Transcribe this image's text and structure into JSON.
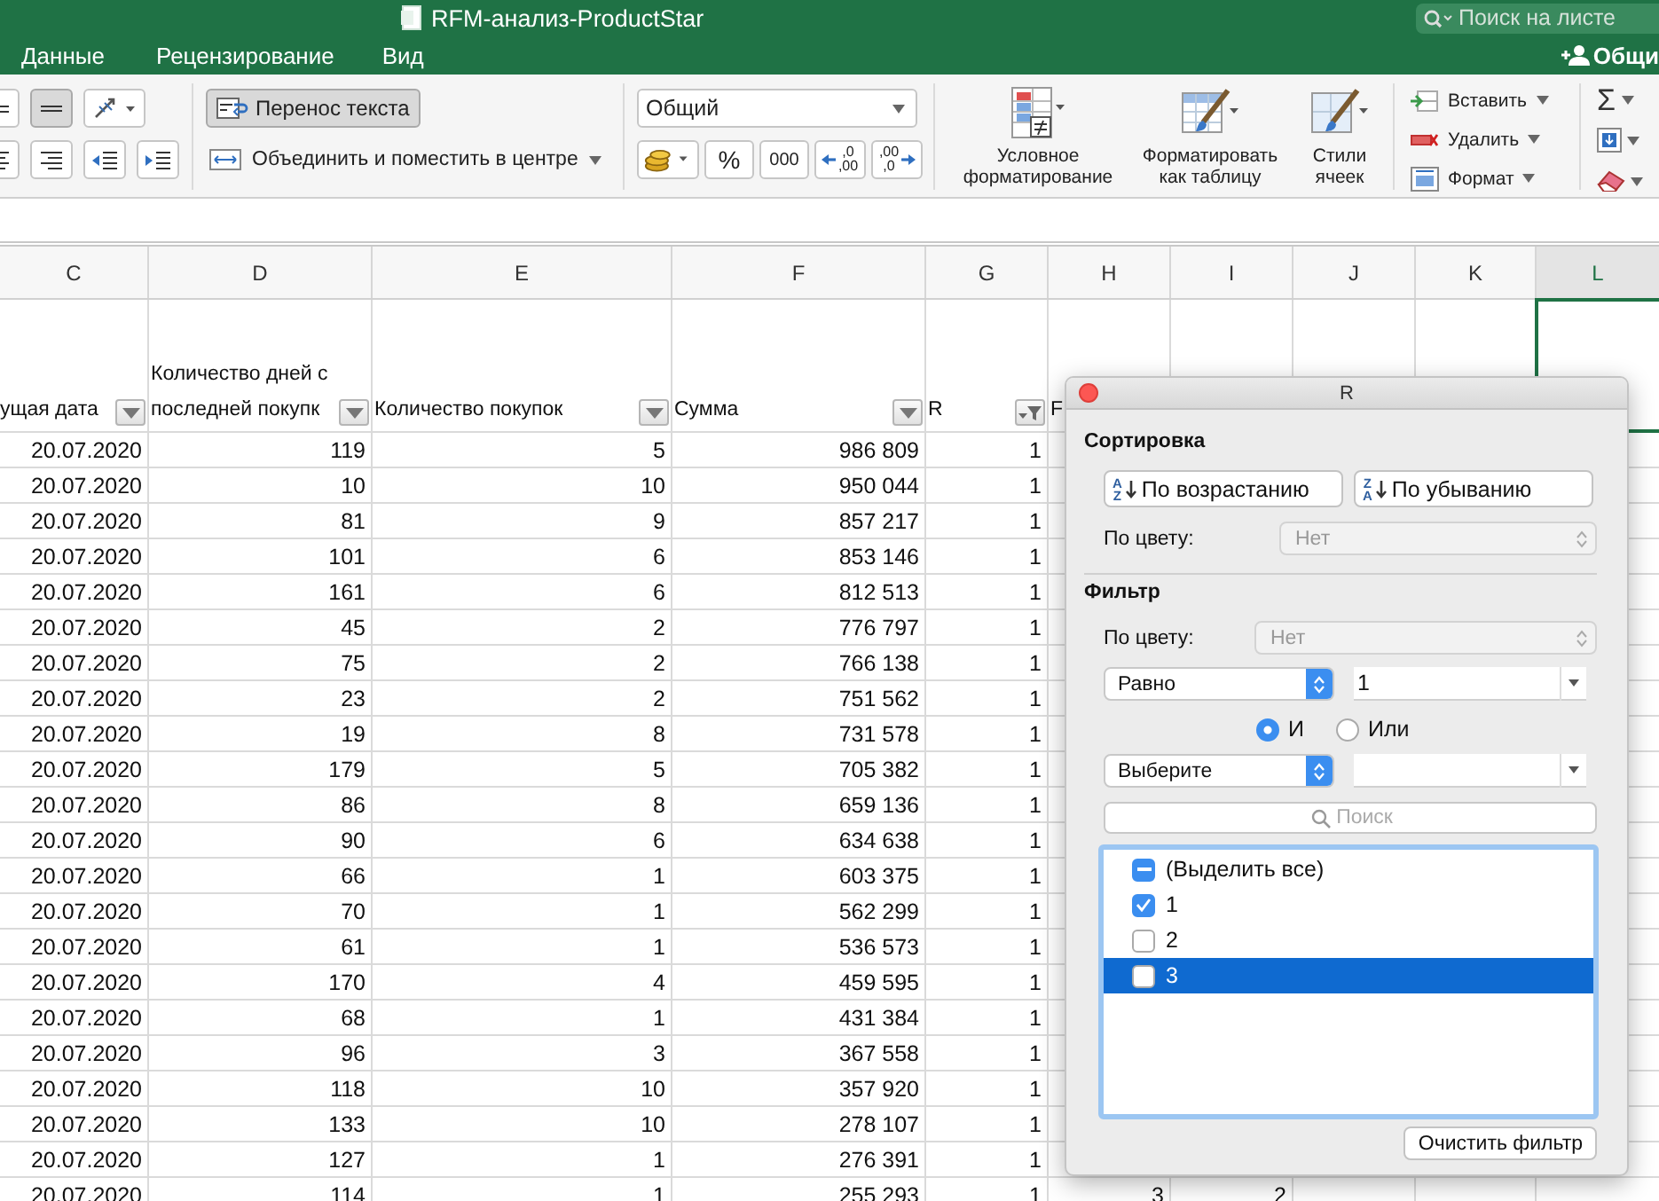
{
  "window": {
    "title": "RFM-анализ-ProductStar",
    "search_placeholder": "Поиск на листе"
  },
  "ribbon_tabs": [
    {
      "label": "Данные"
    },
    {
      "label": "Рецензирование"
    },
    {
      "label": "Вид"
    }
  ],
  "share_label": "Общи",
  "ribbon": {
    "align_row1": [
      {
        "kind": "align-middle",
        "on": false
      },
      {
        "kind": "align-bottom",
        "on": true
      },
      {
        "kind": "orientation",
        "on": false
      }
    ],
    "align_row2": [
      {
        "kind": "align-center"
      },
      {
        "kind": "align-right"
      },
      {
        "kind": "outdent"
      },
      {
        "kind": "indent"
      }
    ],
    "wrap_text": {
      "label": "Перенос текста",
      "on": true
    },
    "merge": {
      "label": "Объединить и поместить в центре"
    },
    "number_format": "Общий",
    "percent": "%",
    "thousands": "000",
    "increase_decimal": [
      ",0",
      ",00"
    ],
    "decrease_decimal": [
      ",00",
      ",0"
    ],
    "styles": [
      {
        "kind": "conditional",
        "label": "Условное форматирование"
      },
      {
        "kind": "table",
        "label": "Форматировать как таблицу"
      },
      {
        "kind": "cell-styles",
        "label": "Стили ячеек"
      }
    ],
    "cells": [
      {
        "kind": "insert",
        "label": "Вставить"
      },
      {
        "kind": "delete",
        "label": "Удалить"
      },
      {
        "kind": "format",
        "label": "Формат"
      }
    ],
    "editing": [
      {
        "kind": "sum",
        "glyph": "Σ"
      },
      {
        "kind": "fill"
      },
      {
        "kind": "clear"
      }
    ]
  },
  "columns": [
    {
      "letter": "C",
      "selected": false
    },
    {
      "letter": "D",
      "selected": false
    },
    {
      "letter": "E",
      "selected": false
    },
    {
      "letter": "F",
      "selected": false
    },
    {
      "letter": "G",
      "selected": false
    },
    {
      "letter": "H",
      "selected": false
    },
    {
      "letter": "I",
      "selected": false
    },
    {
      "letter": "J",
      "selected": false
    },
    {
      "letter": "K",
      "selected": false
    },
    {
      "letter": "L",
      "selected": true
    }
  ],
  "header_cells": [
    {
      "text": "ущая дата",
      "filtered": false
    },
    {
      "text": "Количество дней с последней покупк",
      "filtered": false
    },
    {
      "text": "Количество покупок",
      "filtered": false
    },
    {
      "text": "Сумма",
      "filtered": false
    },
    {
      "text": "R",
      "filtered": true
    },
    {
      "text": "F"
    }
  ],
  "rows": [
    [
      "20.07.2020",
      "119",
      "5",
      "986 809",
      "1"
    ],
    [
      "20.07.2020",
      "10",
      "10",
      "950 044",
      "1"
    ],
    [
      "20.07.2020",
      "81",
      "9",
      "857 217",
      "1"
    ],
    [
      "20.07.2020",
      "101",
      "6",
      "853 146",
      "1"
    ],
    [
      "20.07.2020",
      "161",
      "6",
      "812 513",
      "1"
    ],
    [
      "20.07.2020",
      "45",
      "2",
      "776 797",
      "1"
    ],
    [
      "20.07.2020",
      "75",
      "2",
      "766 138",
      "1"
    ],
    [
      "20.07.2020",
      "23",
      "2",
      "751 562",
      "1"
    ],
    [
      "20.07.2020",
      "19",
      "8",
      "731 578",
      "1"
    ],
    [
      "20.07.2020",
      "179",
      "5",
      "705 382",
      "1"
    ],
    [
      "20.07.2020",
      "86",
      "8",
      "659 136",
      "1"
    ],
    [
      "20.07.2020",
      "90",
      "6",
      "634 638",
      "1"
    ],
    [
      "20.07.2020",
      "66",
      "1",
      "603 375",
      "1"
    ],
    [
      "20.07.2020",
      "70",
      "1",
      "562 299",
      "1"
    ],
    [
      "20.07.2020",
      "61",
      "1",
      "536 573",
      "1"
    ],
    [
      "20.07.2020",
      "170",
      "4",
      "459 595",
      "1"
    ],
    [
      "20.07.2020",
      "68",
      "1",
      "431 384",
      "1"
    ],
    [
      "20.07.2020",
      "96",
      "3",
      "367 558",
      "1"
    ],
    [
      "20.07.2020",
      "118",
      "10",
      "357 920",
      "1"
    ],
    [
      "20.07.2020",
      "133",
      "10",
      "278 107",
      "1"
    ],
    [
      "20.07.2020",
      "127",
      "1",
      "276 391",
      "1"
    ],
    [
      "20.07.2020",
      "114",
      "1",
      "255 293",
      "1",
      "3",
      "2"
    ]
  ],
  "filter_popup": {
    "title": "R",
    "sort": {
      "heading": "Сортировка",
      "ascending": {
        "label": "По возрастанию",
        "letters": [
          "A",
          "Z"
        ]
      },
      "descending": {
        "label": "По убыванию",
        "letters": [
          "Z",
          "A"
        ]
      },
      "by_color_label": "По цвету:",
      "by_color_value": "Нет"
    },
    "filter": {
      "heading": "Фильтр",
      "by_color_label": "По цвету:",
      "by_color_value": "Нет",
      "condition1": "Равно",
      "value1": "1",
      "logic": [
        {
          "label": "И",
          "selected": true
        },
        {
          "label": "Или",
          "selected": false
        }
      ],
      "condition2": "Выберите",
      "search_placeholder": "Поиск",
      "items": [
        {
          "label": "(Выделить все)",
          "checked": false,
          "mixed": true,
          "selected": false
        },
        {
          "label": "1",
          "checked": true,
          "selected": false
        },
        {
          "label": "2",
          "checked": false,
          "selected": false
        },
        {
          "label": "3",
          "checked": false,
          "selected": true
        }
      ]
    },
    "clear_button": "Очистить фильтр"
  }
}
